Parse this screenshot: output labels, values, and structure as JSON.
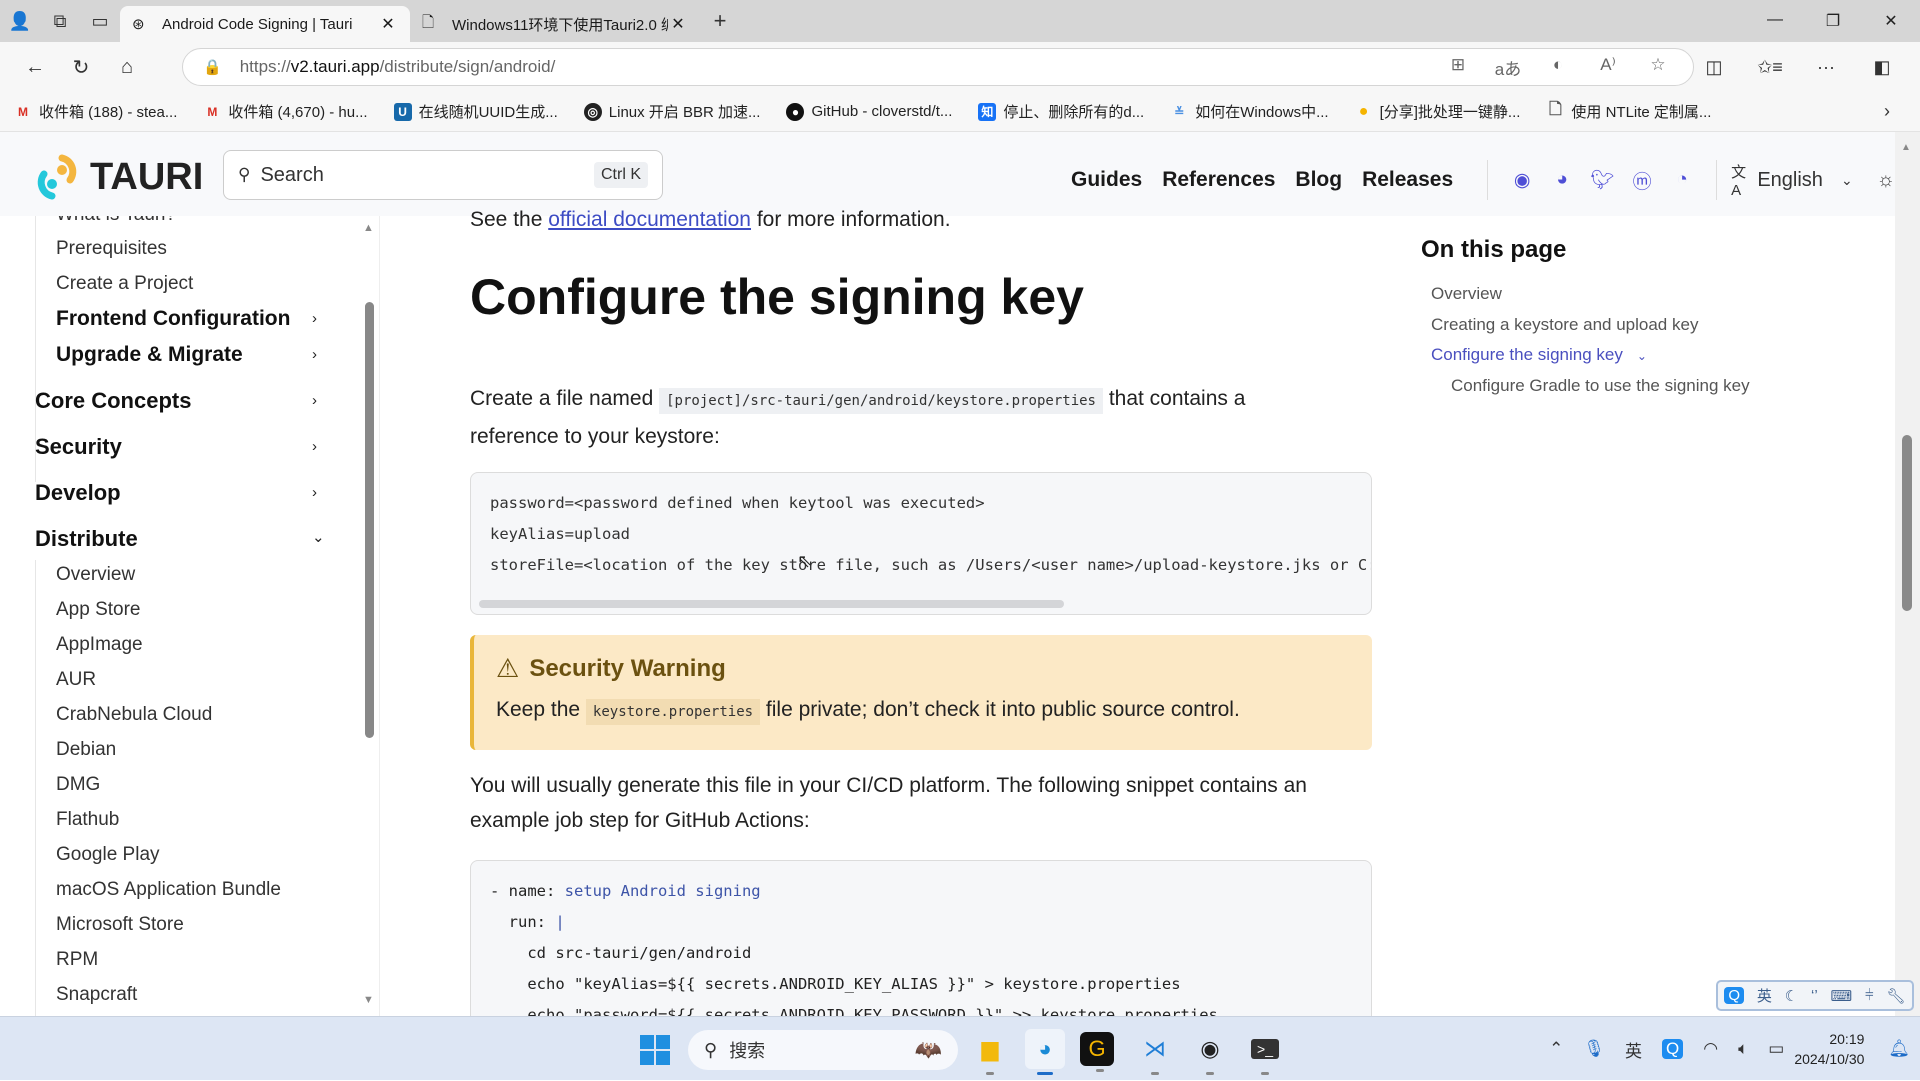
{
  "browser": {
    "tabs": [
      {
        "title": "Android Code Signing | Tauri",
        "icon": "tauri-favicon-icon",
        "active": true
      },
      {
        "title": "Windows11环境下使用Tauri2.0 编",
        "icon": "document-icon",
        "active": false
      }
    ],
    "url": {
      "scheme": "https://",
      "host": "v2.tauri.app",
      "path": "/distribute/sign/android/"
    },
    "bookmarks": [
      {
        "label": "收件箱 (188) - stea...",
        "icon": "gmail-icon",
        "color": "#d93025"
      },
      {
        "label": "收件箱 (4,670) - hu...",
        "icon": "gmail-icon",
        "color": "#d93025"
      },
      {
        "label": "在线随机UUID生成...",
        "icon": "u-icon",
        "color": "#1769aa"
      },
      {
        "label": "Linux 开启 BBR 加速...",
        "icon": "circle-logo-icon",
        "color": "#222222"
      },
      {
        "label": "GitHub - cloverstd/t...",
        "icon": "github-icon",
        "color": "#111111"
      },
      {
        "label": "停止、删除所有的d...",
        "icon": "zhihu-icon",
        "color": "#1772f6"
      },
      {
        "label": "如何在Windows中...",
        "icon": "chevrons-icon",
        "color": "#4a90e2"
      },
      {
        "label": "[分享]批处理一键静...",
        "icon": "bulb-icon",
        "color": "#f5b400"
      },
      {
        "label": "使用 NTLite 定制属...",
        "icon": "document-icon",
        "color": "#555555"
      }
    ]
  },
  "site": {
    "logo": "TAURI",
    "search": {
      "placeholder": "Search",
      "shortcut": "Ctrl K"
    },
    "nav": [
      "Guides",
      "References",
      "Blog",
      "Releases"
    ],
    "language": "English",
    "accent": "#3d4cc4"
  },
  "sidebar": {
    "partial_top": "What is Tauri?",
    "sub_items": [
      "Prerequisites",
      "Create a Project"
    ],
    "sub_groups": [
      "Frontend Configuration",
      "Upgrade & Migrate"
    ],
    "groups": [
      "Core Concepts",
      "Security",
      "Develop",
      "Distribute"
    ],
    "distribute_items": [
      "Overview",
      "App Store",
      "AppImage",
      "AUR",
      "CrabNebula Cloud",
      "Debian",
      "DMG",
      "Flathub",
      "Google Play",
      "macOS Application Bundle",
      "Microsoft Store",
      "RPM",
      "Snapcraft"
    ]
  },
  "content": {
    "intro_prefix": "See the ",
    "intro_link": "official documentation",
    "intro_suffix": " for more information.",
    "heading": "Configure the signing key",
    "para1_prefix": "Create a file named ",
    "para1_code": "[project]/src-tauri/gen/android/keystore.properties",
    "para1_suffix": " that contains a reference to your keystore:",
    "code1": "password=<password defined when keytool was executed>\nkeyAlias=upload\nstoreFile=<location of the key store file, such as /Users/<user name>/upload-keystore.jks or C:\\Users\\<user name>\\upload-keystore.jks>",
    "warning": {
      "title": "Security Warning",
      "prefix": "Keep the ",
      "code": "keystore.properties",
      "suffix": " file private; don’t check it into public source control."
    },
    "para2": "You will usually generate this file in your CI/CD platform. The following snippet contains an example job step for GitHub Actions:",
    "code2": [
      {
        "k": "- name: ",
        "v": "setup Android signing"
      },
      {
        "k": "  run: ",
        "v": "|"
      },
      {
        "k": "",
        "v": "    cd src-tauri/gen/android"
      },
      {
        "k": "",
        "v": "    echo \"keyAlias=${{ secrets.ANDROID_KEY_ALIAS }}\" > keystore.properties"
      },
      {
        "k": "",
        "v": "    echo \"password=${{ secrets.ANDROID_KEY_PASSWORD }}\" >> keystore.properties"
      }
    ]
  },
  "toc": {
    "title": "On this page",
    "items": [
      "Overview",
      "Creating a keystore and upload key",
      "Configure the signing key",
      "Configure Gradle to use the signing key"
    ],
    "active_index": 2
  },
  "taskbar": {
    "search_placeholder": "搜索",
    "ime_lang": "英",
    "time": "20:19",
    "date": "2024/10/30"
  }
}
